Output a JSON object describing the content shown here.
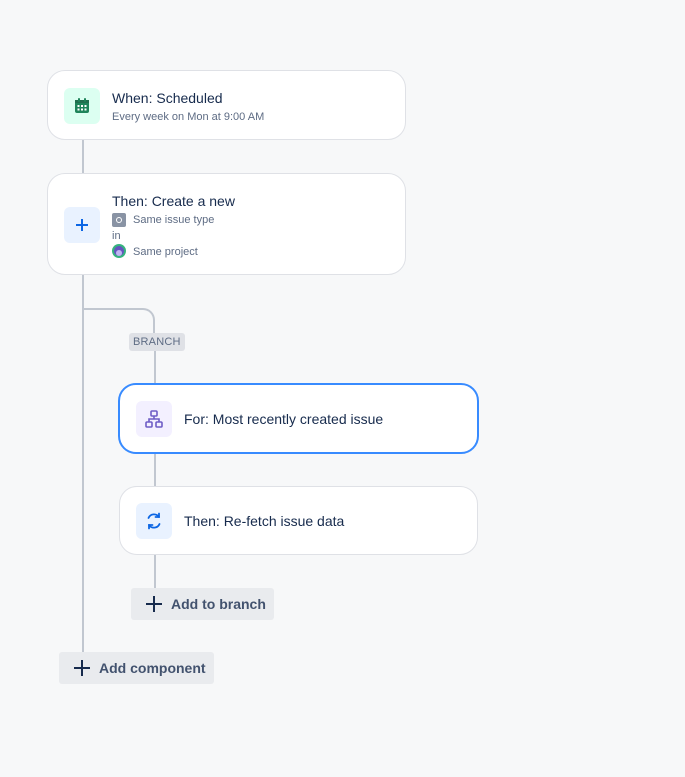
{
  "trigger": {
    "title": "When: Scheduled",
    "subtitle": "Every week on Mon at 9:00 AM",
    "icon": "calendar-icon",
    "accent": "#1f845a"
  },
  "create_action": {
    "title": "Then: Create a new",
    "issue_type": "Same issue type",
    "in_label": "in",
    "project": "Same project",
    "icon": "plus-icon"
  },
  "branch": {
    "label": "BRANCH",
    "for_card": {
      "title": "For: Most recently created issue",
      "icon": "branch-hierarchy-icon"
    },
    "refetch_card": {
      "title": "Then: Re-fetch issue data",
      "icon": "refresh-icon"
    },
    "add_to_branch_label": "Add to branch"
  },
  "add_component_label": "Add component",
  "colors": {
    "selected_border": "#388bff",
    "rail": "#c1c7d0"
  }
}
